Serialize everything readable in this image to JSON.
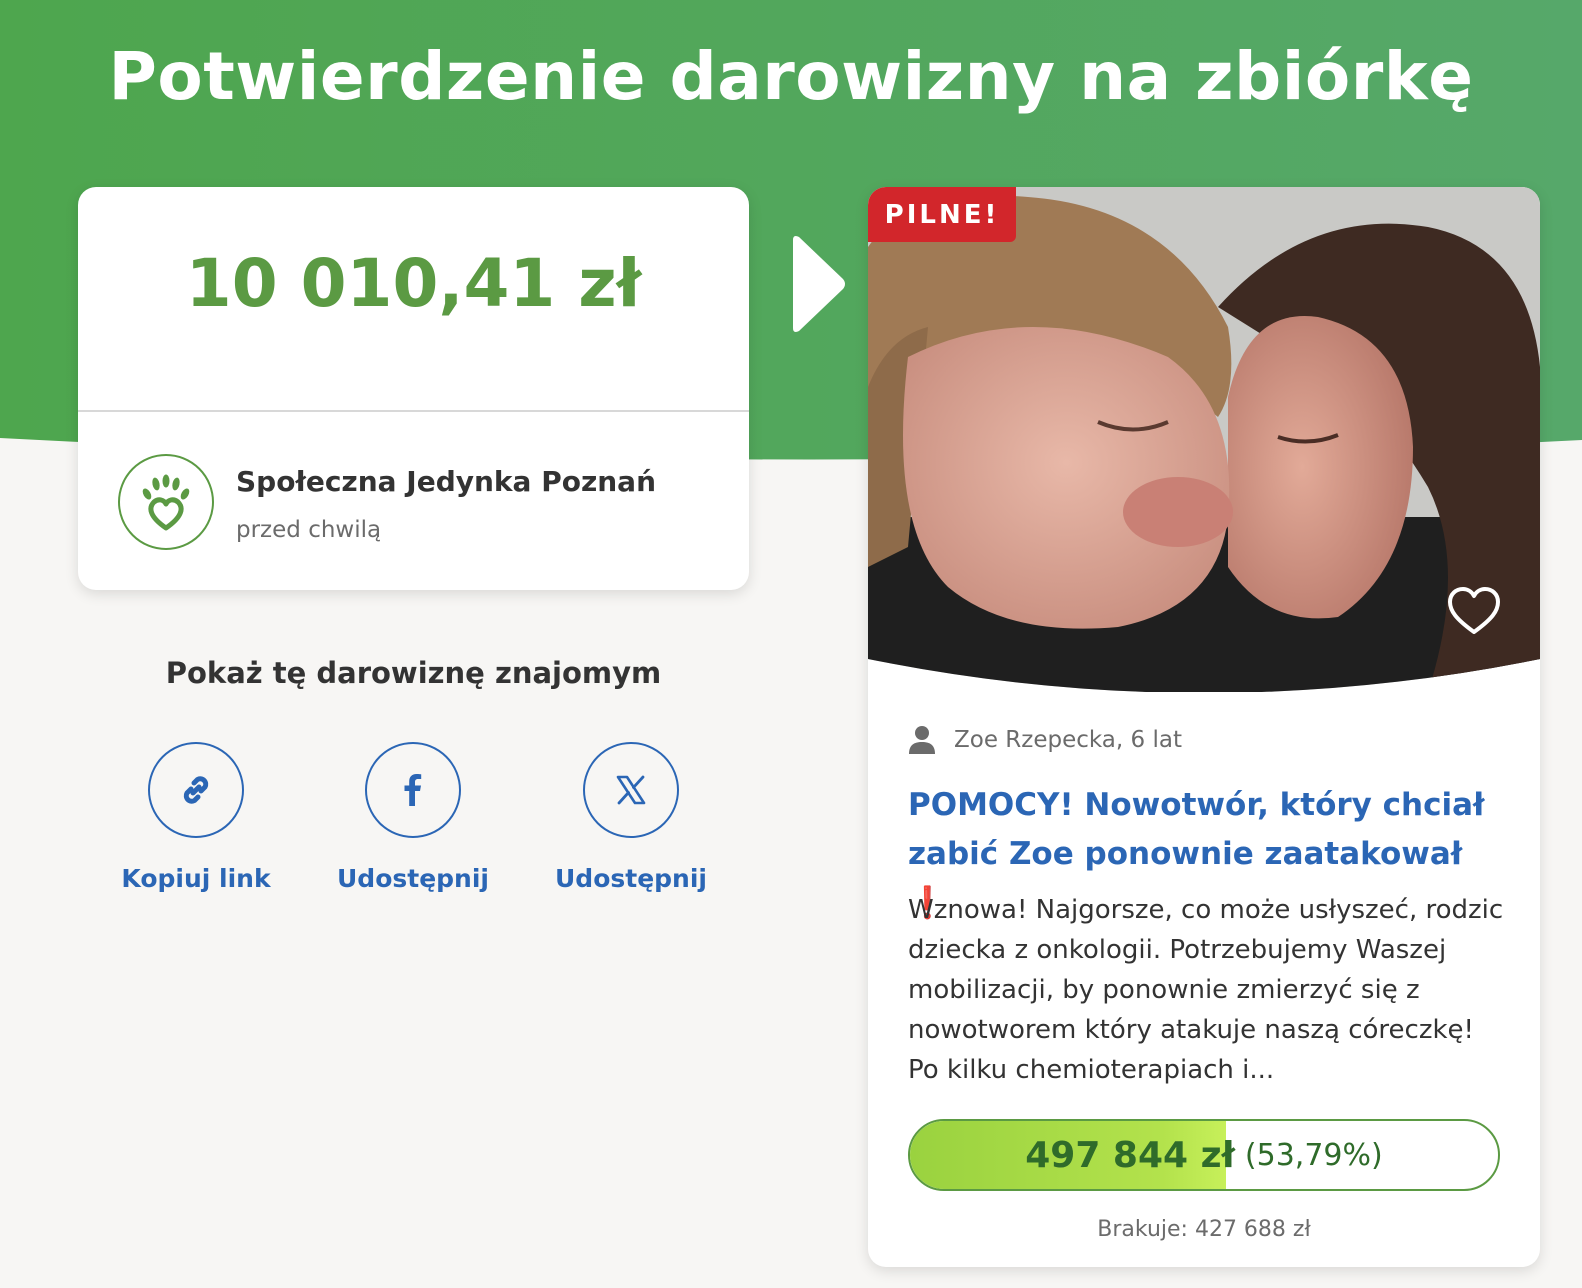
{
  "page": {
    "title": "Potwierdzenie darowizny na zbiórkę"
  },
  "donation": {
    "amount": "10 010,41 zł",
    "organization": "Społeczna Jedynka Poznań",
    "time": "przed chwilą"
  },
  "share": {
    "heading": "Pokaż tę darowiznę znajomym",
    "items": [
      {
        "icon": "link-icon",
        "label": "Kopiuj link"
      },
      {
        "icon": "facebook-icon",
        "label": "Udostępnij"
      },
      {
        "icon": "x-icon",
        "label": "Udostępnij"
      }
    ]
  },
  "campaign": {
    "badge": "PILNE!",
    "beneficiary": "Zoe Rzepecka, 6 lat",
    "title": "POMOCY! Nowotwór, który chciał zabić Zoe ponownie zaatakował",
    "title_emoji": "❗",
    "description": "Wznowa! Najgorsze, co może usłyszeć, rodzic dziecka z onkologii. Potrzebujemy Waszej mobilizacji, by ponownie zmierzyć się z nowotworem który atakuje naszą córeczkę! Po kilku chemioterapiach i...",
    "raised": "497 844 zł",
    "percent": "(53,79%)",
    "progress_fraction": 0.5379,
    "remaining": "Brakuje: 427 688 zł"
  },
  "colors": {
    "brand_green": "#5b9a43",
    "link_blue": "#2b66b5",
    "urgent_red": "#d2262b"
  }
}
